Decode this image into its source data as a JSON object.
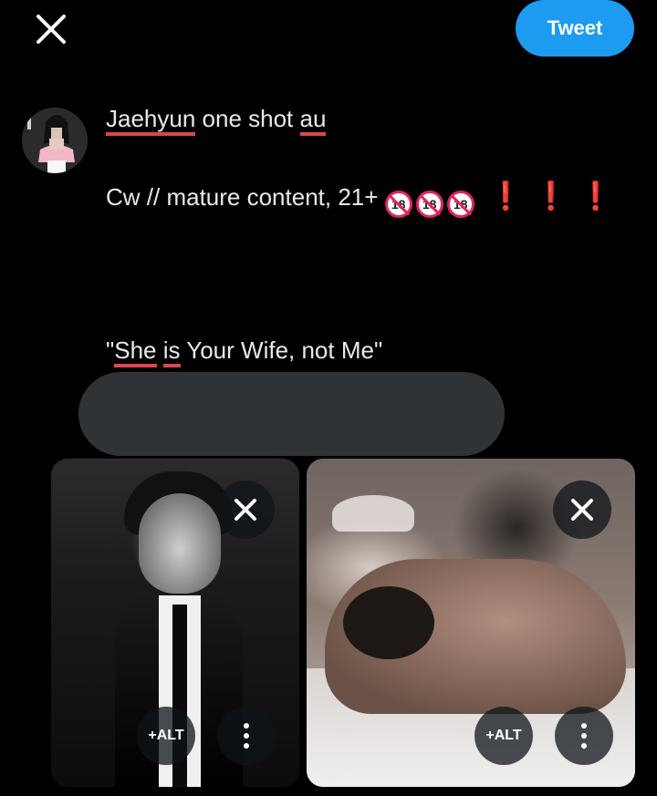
{
  "header": {
    "close_icon": "close-icon",
    "tweet_label": "Tweet",
    "accent": "#1d9bf0"
  },
  "compose": {
    "line1_word1": "Jaehyun",
    "line1_mid": " one shot ",
    "line1_word2": "au",
    "line2_text": "Cw // mature content, 21+ ",
    "line2_emoji": "18",
    "line3_open": "\"",
    "line3_she": "She",
    "line3_space1": " ",
    "line3_is": "is",
    "line3_rest": " Your Wife, not Me\""
  },
  "media": [
    {
      "alt_label": "+ALT",
      "remove_icon": "close-icon",
      "more_icon": "more-vertical-icon"
    },
    {
      "alt_label": "+ALT",
      "remove_icon": "close-icon",
      "more_icon": "more-vertical-icon"
    }
  ],
  "colors": {
    "background": "#000000",
    "text": "#e7e9ea",
    "spellcheck": "#e0444f",
    "warning": "#e0245e",
    "grey_bar": "#2f3336"
  }
}
